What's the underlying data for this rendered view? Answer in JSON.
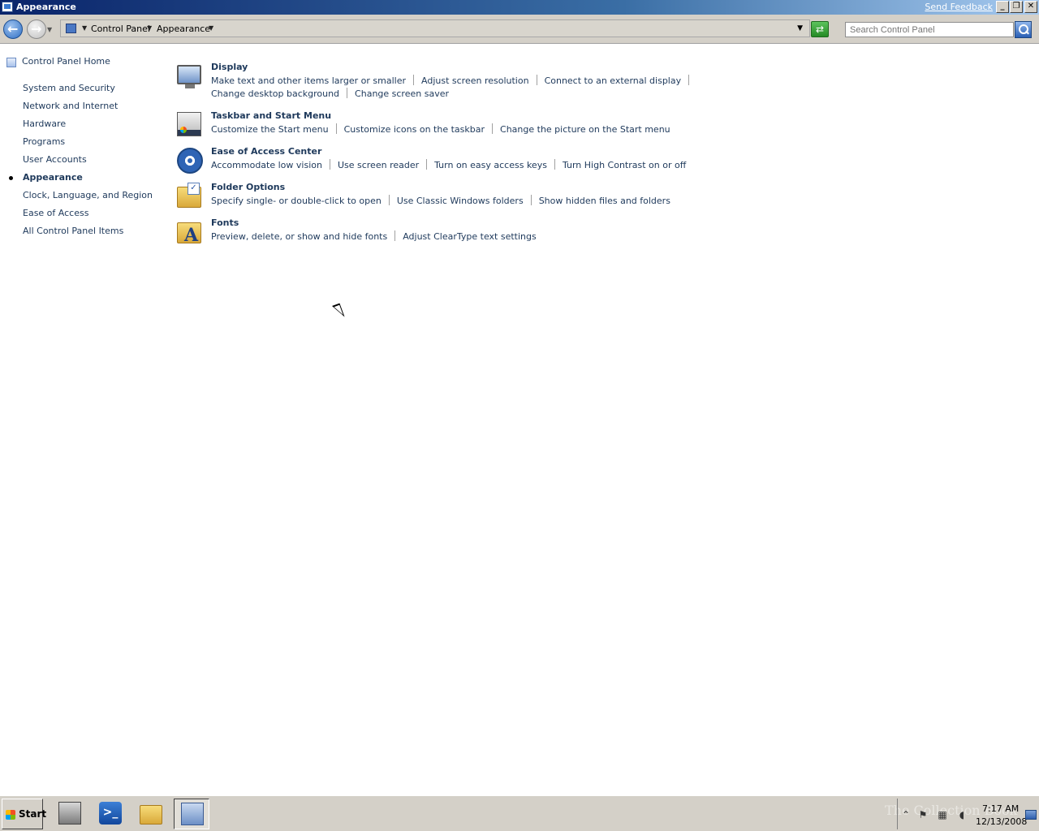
{
  "window": {
    "title": "Appearance",
    "feedback_link": "Send Feedback",
    "buttons": {
      "minimize": "_",
      "maximize": "❐",
      "close": "✕"
    }
  },
  "address": {
    "breadcrumbs": [
      "Control Panel",
      "Appearance"
    ],
    "search_placeholder": "Search Control Panel"
  },
  "sidebar": {
    "home": "Control Panel Home",
    "items": [
      {
        "label": "System and Security",
        "current": false
      },
      {
        "label": "Network and Internet",
        "current": false
      },
      {
        "label": "Hardware",
        "current": false
      },
      {
        "label": "Programs",
        "current": false
      },
      {
        "label": "User Accounts",
        "current": false
      },
      {
        "label": "Appearance",
        "current": true
      },
      {
        "label": "Clock, Language, and Region",
        "current": false
      },
      {
        "label": "Ease of Access",
        "current": false
      },
      {
        "label": "All Control Panel Items",
        "current": false
      }
    ]
  },
  "categories": [
    {
      "title": "Display",
      "icon": "display-icon",
      "links_row1": [
        "Make text and other items larger or smaller",
        "Adjust screen resolution",
        "Connect to an external display"
      ],
      "links_row2": [
        "Change desktop background",
        "Change screen saver"
      ]
    },
    {
      "title": "Taskbar and Start Menu",
      "icon": "taskbar-icon",
      "links": [
        "Customize the Start menu",
        "Customize icons on the taskbar",
        "Change the picture on the Start menu"
      ]
    },
    {
      "title": "Ease of Access Center",
      "icon": "ease-of-access-icon",
      "links": [
        "Accommodate low vision",
        "Use screen reader",
        "Turn on easy access keys",
        "Turn High Contrast on or off"
      ]
    },
    {
      "title": "Folder Options",
      "icon": "folder-options-icon",
      "links": [
        "Specify single- or double-click to open",
        "Use Classic Windows folders",
        "Show hidden files and folders"
      ]
    },
    {
      "title": "Fonts",
      "icon": "fonts-icon",
      "links": [
        "Preview, delete, or show and hide fonts",
        "Adjust ClearType text settings"
      ]
    }
  ],
  "taskbar": {
    "start_label": "Start",
    "clock_time": "7:17 AM",
    "clock_date": "12/13/2008",
    "watermark": "The Collection Book"
  }
}
